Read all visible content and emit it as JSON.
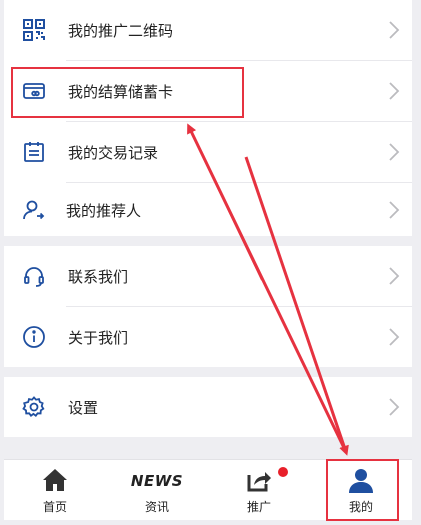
{
  "menu_items": [
    {
      "label": "我的推广二维码",
      "icon": "qr-code-icon"
    },
    {
      "label": "我的结算储蓄卡",
      "icon": "bank-card-icon"
    },
    {
      "label": "我的交易记录",
      "icon": "calendar-list-icon"
    },
    {
      "label": "我的推荐人",
      "icon": "referrer-icon"
    },
    {
      "label": "联系我们",
      "icon": "headset-icon"
    },
    {
      "label": "关于我们",
      "icon": "info-icon"
    },
    {
      "label": "设置",
      "icon": "settings-gear-icon"
    }
  ],
  "tabbar": {
    "home": "首页",
    "news_logo": "NEWS",
    "news": "资讯",
    "promote": "推广",
    "mine": "我的"
  },
  "colors": {
    "icon_blue": "#1f4fa0",
    "annotation_red": "#e63240",
    "badge_red": "#e8202a",
    "active_tab_blue": "#1f4fa0"
  }
}
